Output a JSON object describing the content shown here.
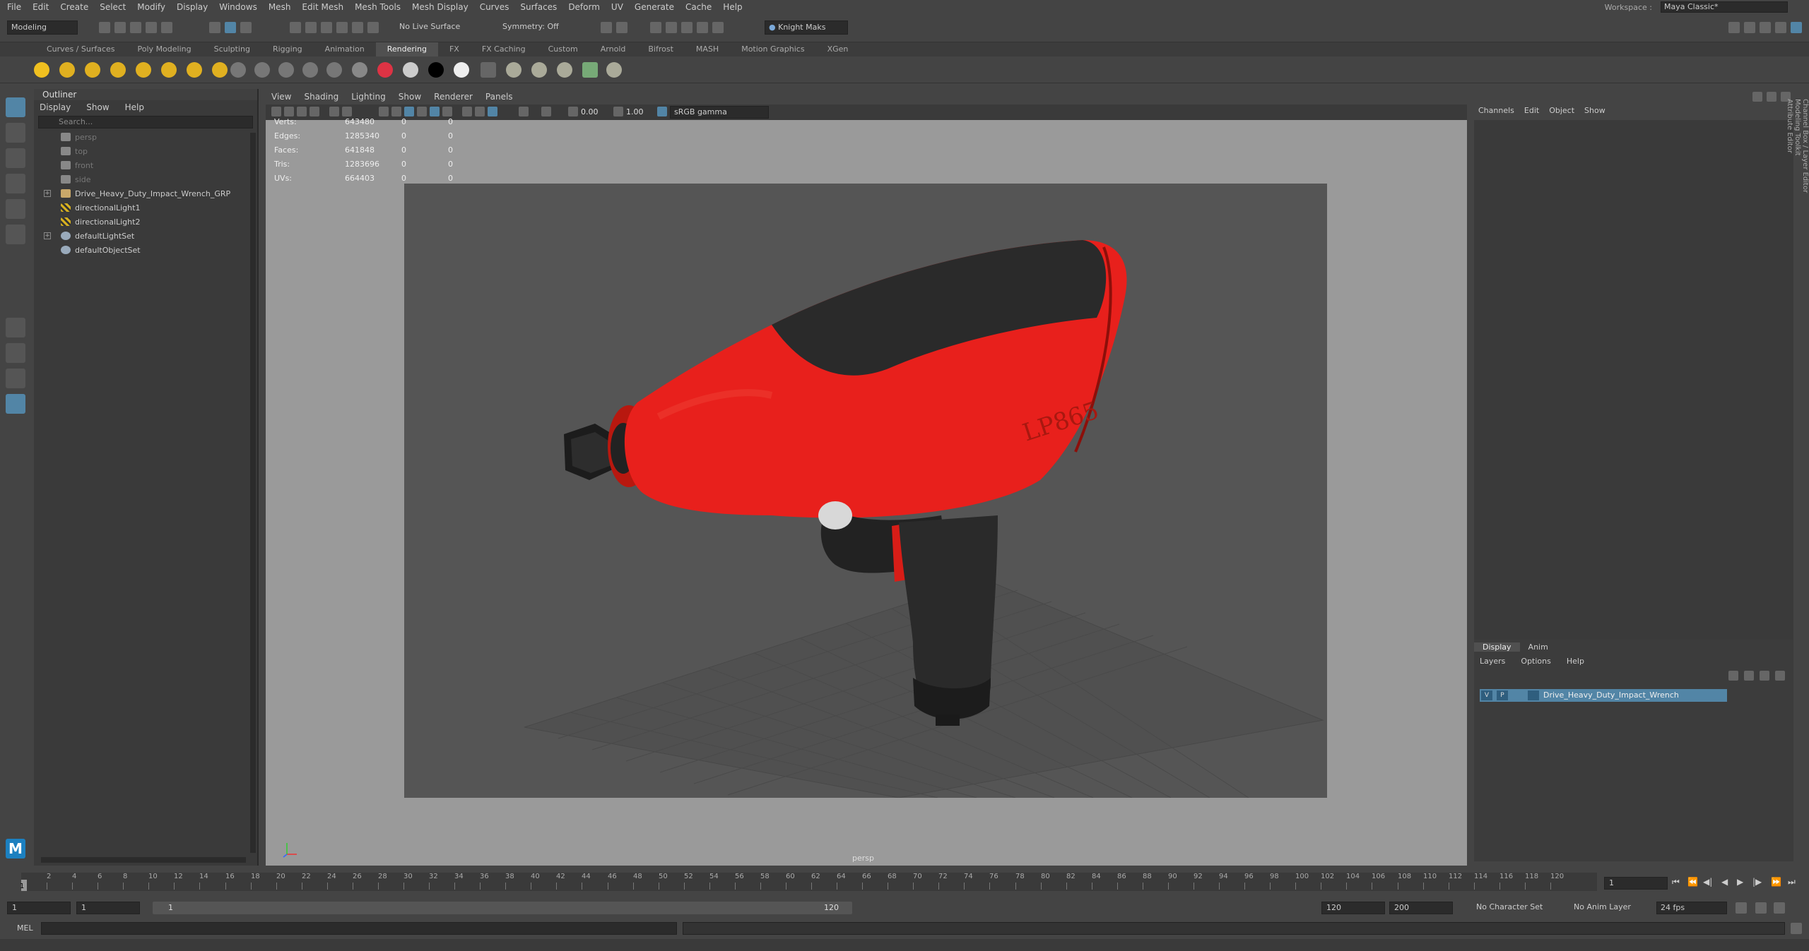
{
  "menubar": {
    "items": [
      "File",
      "Edit",
      "Create",
      "Select",
      "Modify",
      "Display",
      "Windows",
      "Mesh",
      "Edit Mesh",
      "Mesh Tools",
      "Mesh Display",
      "Curves",
      "Surfaces",
      "Deform",
      "UV",
      "Generate",
      "Cache",
      "Help"
    ],
    "workspace_label": "Workspace :",
    "workspace_value": "Maya Classic*"
  },
  "statusline": {
    "mode": "Modeling",
    "live_surface": "No Live Surface",
    "symmetry": "Symmetry: Off",
    "user": "Knight Maks"
  },
  "shelf": {
    "tabs": [
      "Curves / Surfaces",
      "Poly Modeling",
      "Sculpting",
      "Rigging",
      "Animation",
      "Rendering",
      "FX",
      "FX Caching",
      "Custom",
      "Arnold",
      "Bifrost",
      "MASH",
      "Motion Graphics",
      "XGen"
    ],
    "active_tab": "Rendering"
  },
  "outliner": {
    "title": "Outliner",
    "menu": [
      "Display",
      "Show",
      "Help"
    ],
    "search_placeholder": "Search...",
    "items": [
      {
        "label": "persp",
        "dim": true,
        "icon": "camera-icon"
      },
      {
        "label": "top",
        "dim": true,
        "icon": "camera-icon"
      },
      {
        "label": "front",
        "dim": true,
        "icon": "camera-icon"
      },
      {
        "label": "side",
        "dim": true,
        "icon": "camera-icon"
      },
      {
        "label": "Drive_Heavy_Duty_Impact_Wrench_GRP",
        "dim": false,
        "icon": "group-icon",
        "expand": true
      },
      {
        "label": "directionalLight1",
        "dim": false,
        "icon": "light-icon"
      },
      {
        "label": "directionalLight2",
        "dim": false,
        "icon": "light-icon"
      },
      {
        "label": "defaultLightSet",
        "dim": false,
        "icon": "set-icon",
        "expand": true
      },
      {
        "label": "defaultObjectSet",
        "dim": false,
        "icon": "set-icon"
      }
    ]
  },
  "viewport": {
    "menu": [
      "View",
      "Shading",
      "Lighting",
      "Show",
      "Renderer",
      "Panels"
    ],
    "exposure": "0.00",
    "gamma": "1.00",
    "colorspace": "sRGB gamma",
    "camera": "persp",
    "hud": [
      {
        "label": "Verts:",
        "v1": "643480",
        "v2": "0",
        "v3": "0"
      },
      {
        "label": "Edges:",
        "v1": "1285340",
        "v2": "0",
        "v3": "0"
      },
      {
        "label": "Faces:",
        "v1": "641848",
        "v2": "0",
        "v3": "0"
      },
      {
        "label": "Tris:",
        "v1": "1283696",
        "v2": "0",
        "v3": "0"
      },
      {
        "label": "UVs:",
        "v1": "664403",
        "v2": "0",
        "v3": "0"
      }
    ],
    "model_text": "LP865"
  },
  "channelbox": {
    "menu": [
      "Channels",
      "Edit",
      "Object",
      "Show"
    ],
    "side_tabs": [
      "Channel Box / Layer Editor",
      "Modeling Toolkit",
      "Attribute Editor"
    ]
  },
  "layereditor": {
    "tabs": [
      "Display",
      "Anim"
    ],
    "active_tab": "Display",
    "menu": [
      "Layers",
      "Options",
      "Help"
    ],
    "layer": {
      "v": "V",
      "p": "P",
      "name": "Drive_Heavy_Duty_Impact_Wrench"
    }
  },
  "timeslider": {
    "ticks": [
      "2",
      "4",
      "6",
      "8",
      "10",
      "12",
      "14",
      "16",
      "18",
      "20",
      "22",
      "24",
      "26",
      "28",
      "30",
      "32",
      "34",
      "36",
      "38",
      "40",
      "42",
      "44",
      "46",
      "48",
      "50",
      "52",
      "54",
      "56",
      "58",
      "60",
      "62",
      "64",
      "66",
      "68",
      "70",
      "72",
      "74",
      "76",
      "78",
      "80",
      "82",
      "84",
      "86",
      "88",
      "90",
      "92",
      "94",
      "96",
      "98",
      "100",
      "102",
      "104",
      "106",
      "108",
      "110",
      "112",
      "114",
      "116",
      "118",
      "120"
    ],
    "current_frame": "1",
    "frame_field": "1"
  },
  "rangebar": {
    "start": "1",
    "start2": "1",
    "range_start_label": "1",
    "range_end_label": "120",
    "end": "120",
    "end2": "200",
    "character_set": "No Character Set",
    "anim_layer": "No Anim Layer",
    "fps": "24 fps"
  },
  "cmdline": {
    "label": "MEL"
  },
  "colors": {
    "accent": "#5285a6",
    "model_red": "#e8201c",
    "model_black": "#2a2a2a"
  }
}
